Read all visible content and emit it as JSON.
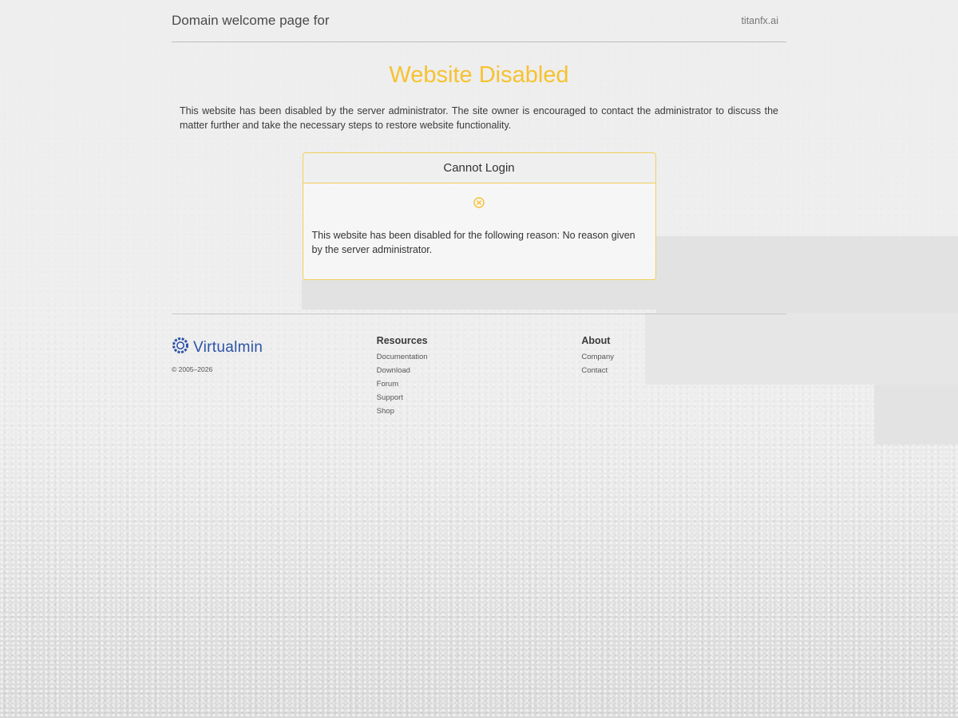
{
  "header": {
    "title": "Domain welcome page for",
    "domain": "titanfx.ai"
  },
  "main": {
    "headline": "Website Disabled",
    "intro": "This website has been disabled by the server administrator. The site owner is encouraged to contact the administrator to discuss the matter further and take the necessary steps to restore website functionality."
  },
  "panel": {
    "title": "Cannot Login",
    "icon": "circle-x-icon",
    "message": "This website has been disabled for the following reason: No reason given by the server administrator."
  },
  "footer": {
    "brand": "Virtualmin",
    "copyright": "© 2005–2026",
    "resources": {
      "heading": "Resources",
      "links": [
        "Documentation",
        "Download",
        "Forum",
        "Support",
        "Shop"
      ]
    },
    "about": {
      "heading": "About",
      "links": [
        "Company",
        "Contact"
      ]
    }
  },
  "colors": {
    "accent": "#f6c230",
    "brand": "#2c52a8"
  }
}
